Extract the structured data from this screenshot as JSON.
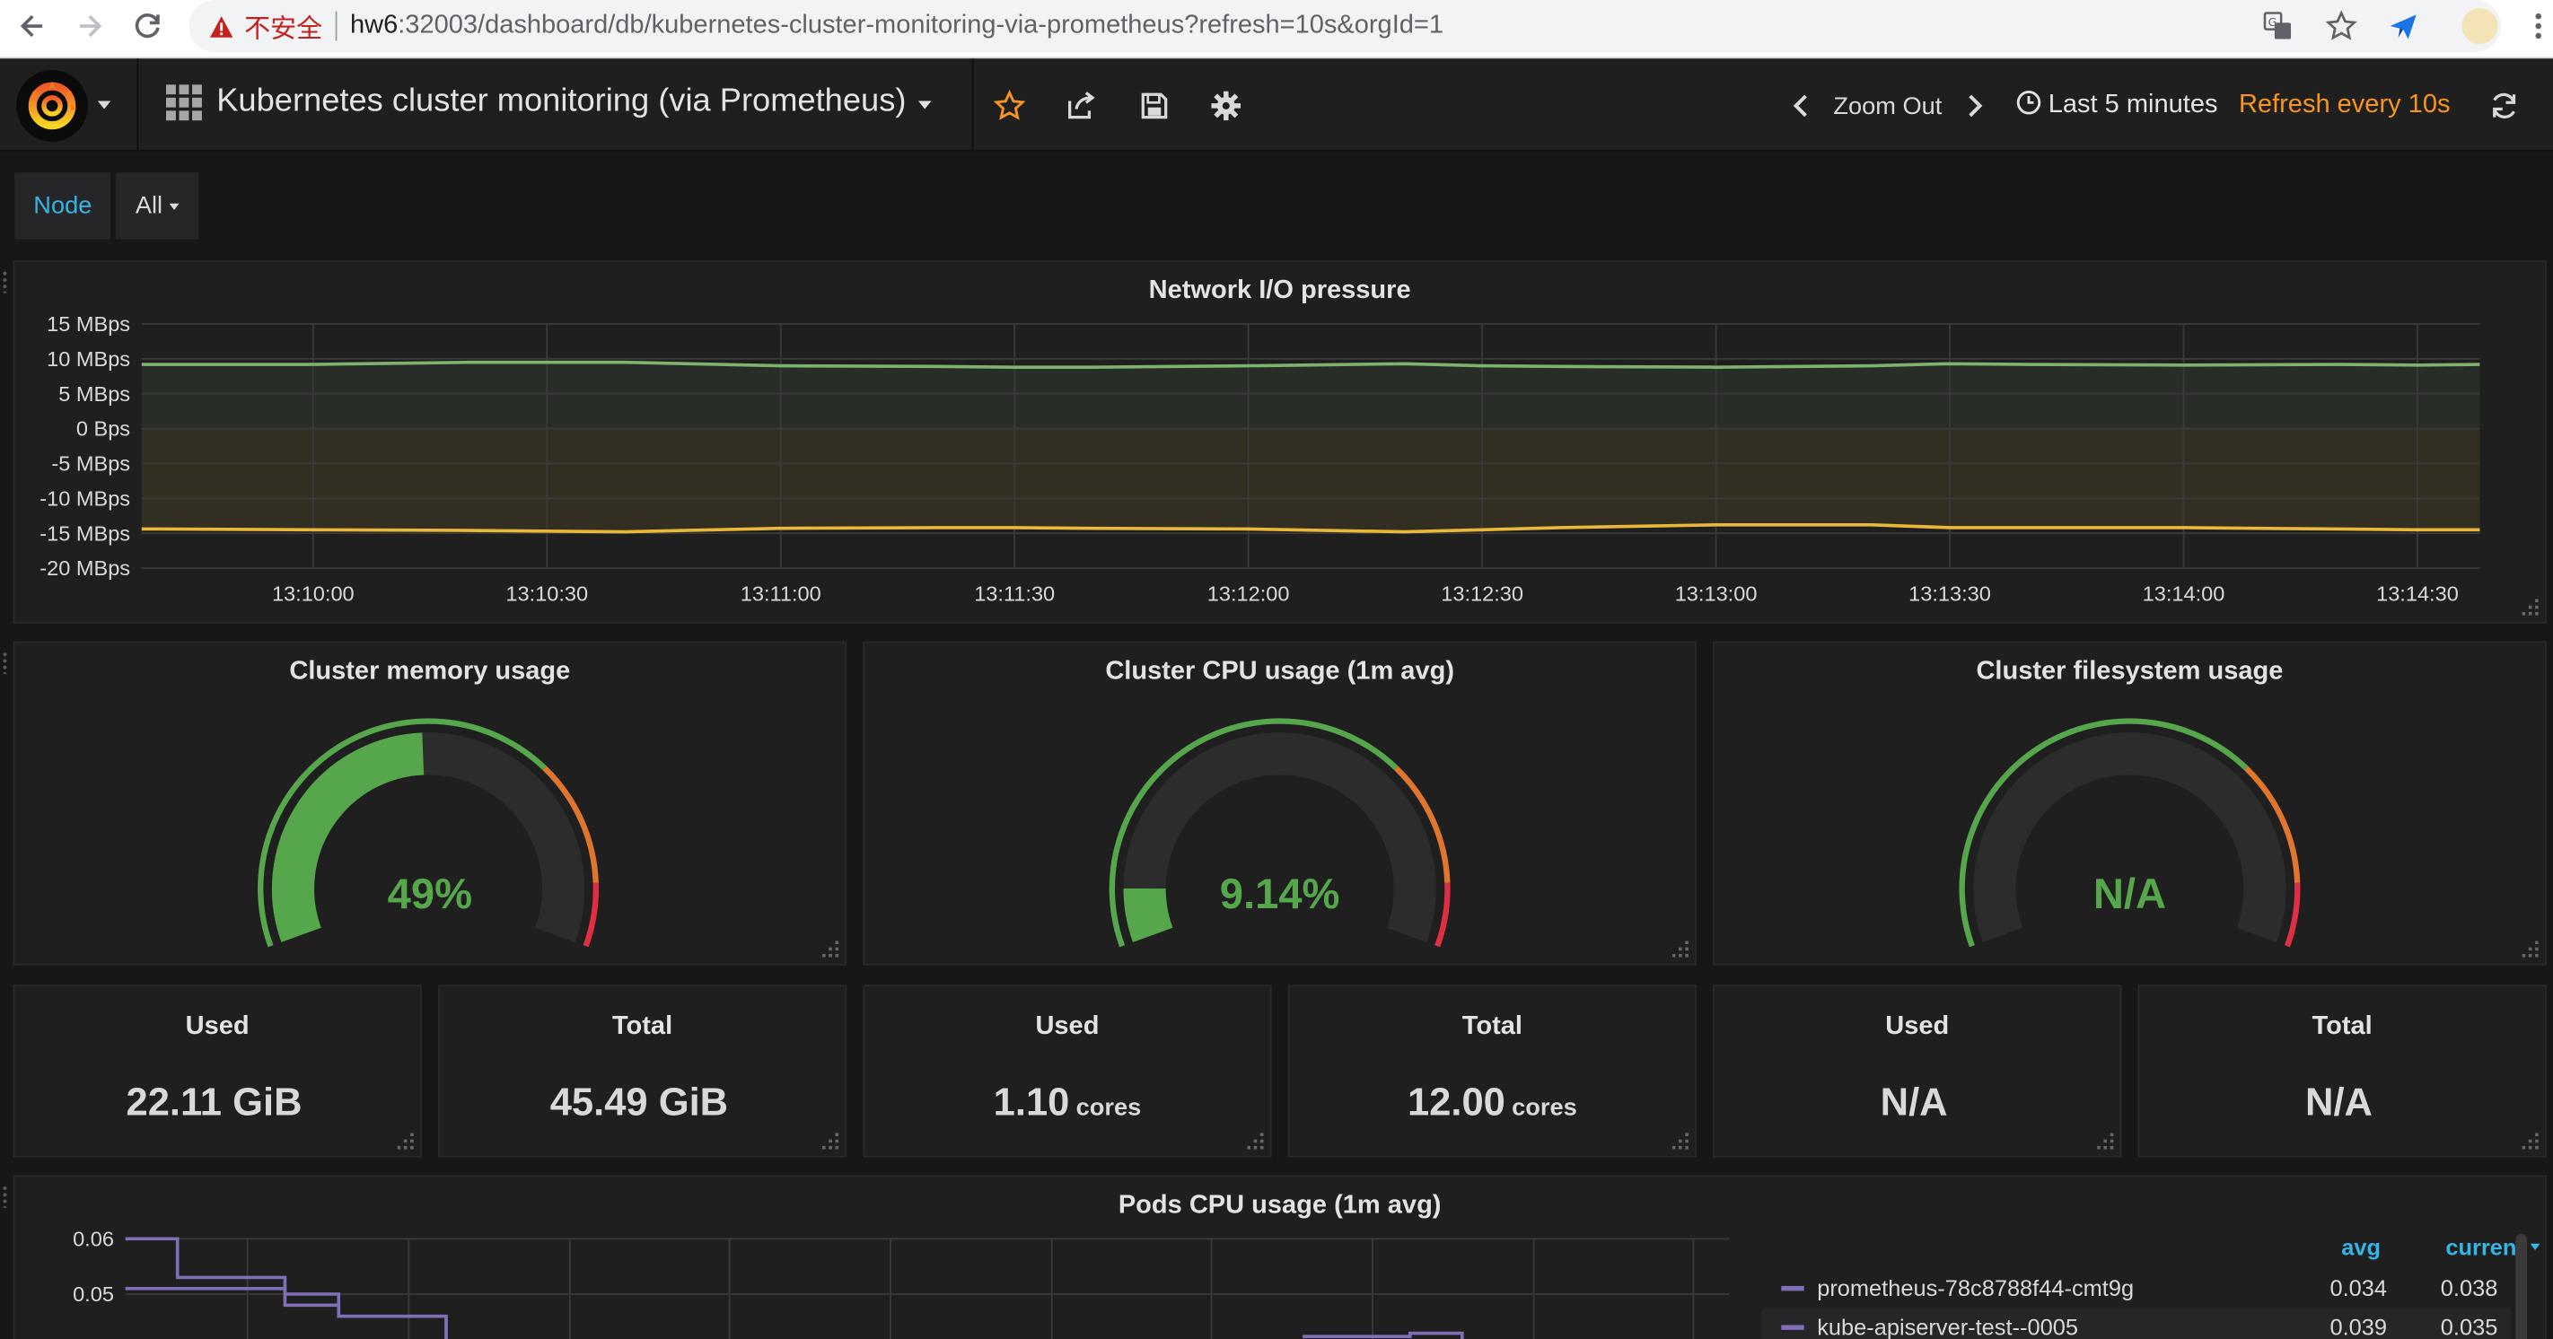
{
  "browser": {
    "insecure_label": "不安全",
    "url_host": "hw6",
    "url_rest": ":32003/dashboard/db/kubernetes-cluster-monitoring-via-prometheus?refresh=10s&orgId=1"
  },
  "navbar": {
    "dashboard_title": "Kubernetes cluster monitoring (via Prometheus)",
    "zoom_out_label": "Zoom Out",
    "time_range_label": "Last 5 minutes",
    "refresh_label": "Refresh every 10s"
  },
  "template_vars": {
    "node_label": "Node",
    "node_value": "All"
  },
  "network_panel": {
    "title": "Network I/O pressure"
  },
  "gauges": [
    {
      "title": "Cluster memory usage",
      "value_text": "49%",
      "value": 49
    },
    {
      "title": "Cluster CPU usage (1m avg)",
      "value_text": "9.14%",
      "value": 9.14
    },
    {
      "title": "Cluster filesystem usage",
      "value_text": "N/A",
      "value": null
    }
  ],
  "stats": [
    {
      "title": "Used",
      "value": "22.11 GiB",
      "unit": ""
    },
    {
      "title": "Total",
      "value": "45.49 GiB",
      "unit": ""
    },
    {
      "title": "Used",
      "value": "1.10",
      "unit": "cores"
    },
    {
      "title": "Total",
      "value": "12.00",
      "unit": "cores"
    },
    {
      "title": "Used",
      "value": "N/A",
      "unit": ""
    },
    {
      "title": "Total",
      "value": "N/A",
      "unit": ""
    }
  ],
  "pods_panel": {
    "title": "Pods CPU usage (1m avg)",
    "legend_header_avg": "avg",
    "legend_header_current": "current",
    "legend_rows": [
      {
        "name": "prometheus-78c8788f44-cmt9g",
        "avg": "0.034",
        "current": "0.038"
      },
      {
        "name": "kube-apiserver-test--0005",
        "avg": "0.039",
        "current": "0.035"
      }
    ]
  },
  "colors": {
    "rx": "#7eb26d",
    "tx": "#eab839",
    "gauge_green": "#56a64b",
    "gauge_orange": "#e0752d",
    "gauge_red": "#e02f44",
    "accent": "#f79520",
    "pods_series": "#806eb7"
  },
  "chart_data": [
    {
      "type": "line",
      "title": "Network I/O pressure",
      "x": [
        "13:09:20",
        "13:09:40",
        "13:10:00",
        "13:10:20",
        "13:10:30",
        "13:10:40",
        "13:11:00",
        "13:11:20",
        "13:11:30",
        "13:11:40",
        "13:12:00",
        "13:12:20",
        "13:12:30",
        "13:12:40",
        "13:13:00",
        "13:13:20",
        "13:13:30",
        "13:13:40",
        "13:14:00",
        "13:14:20",
        "13:14:30",
        "13:14:40"
      ],
      "x_ticks": [
        "13:10:00",
        "13:10:30",
        "13:11:00",
        "13:11:30",
        "13:12:00",
        "13:12:30",
        "13:13:00",
        "13:13:30",
        "13:14:00",
        "13:14:30"
      ],
      "y_ticks": [
        "15 MBps",
        "10 MBps",
        "5 MBps",
        "0 Bps",
        "-5 MBps",
        "-10 MBps",
        "-15 MBps",
        "-20 MBps"
      ],
      "ylim": [
        -20,
        15
      ],
      "y_unit": "MBps",
      "series": [
        {
          "values": [
            9.2,
            9.2,
            9.2,
            9.5,
            9.5,
            9.5,
            9.0,
            8.9,
            8.8,
            8.8,
            9.0,
            9.3,
            9.0,
            8.9,
            8.8,
            9.0,
            9.3,
            9.2,
            9.1,
            9.2,
            9.1,
            9.2
          ]
        },
        {
          "values": [
            -14.4,
            -14.4,
            -14.5,
            -14.6,
            -14.7,
            -14.8,
            -14.3,
            -14.2,
            -14.2,
            -14.3,
            -14.4,
            -14.8,
            -14.5,
            -14.2,
            -13.8,
            -13.8,
            -14.2,
            -14.2,
            -14.2,
            -14.4,
            -14.5,
            -14.5
          ]
        }
      ]
    },
    {
      "type": "line",
      "title": "Pods CPU usage (1m avg)",
      "y_ticks": [
        "0.06",
        "0.05"
      ],
      "series": [
        {
          "name": "prometheus-78c8788f44-cmt9g",
          "values": [
            0.06,
            0.053,
            0.05,
            0.046
          ]
        },
        {
          "name": "kube-apiserver-test--0005",
          "values": [
            0.051,
            0.051,
            0.048,
            0.046
          ]
        }
      ]
    }
  ]
}
